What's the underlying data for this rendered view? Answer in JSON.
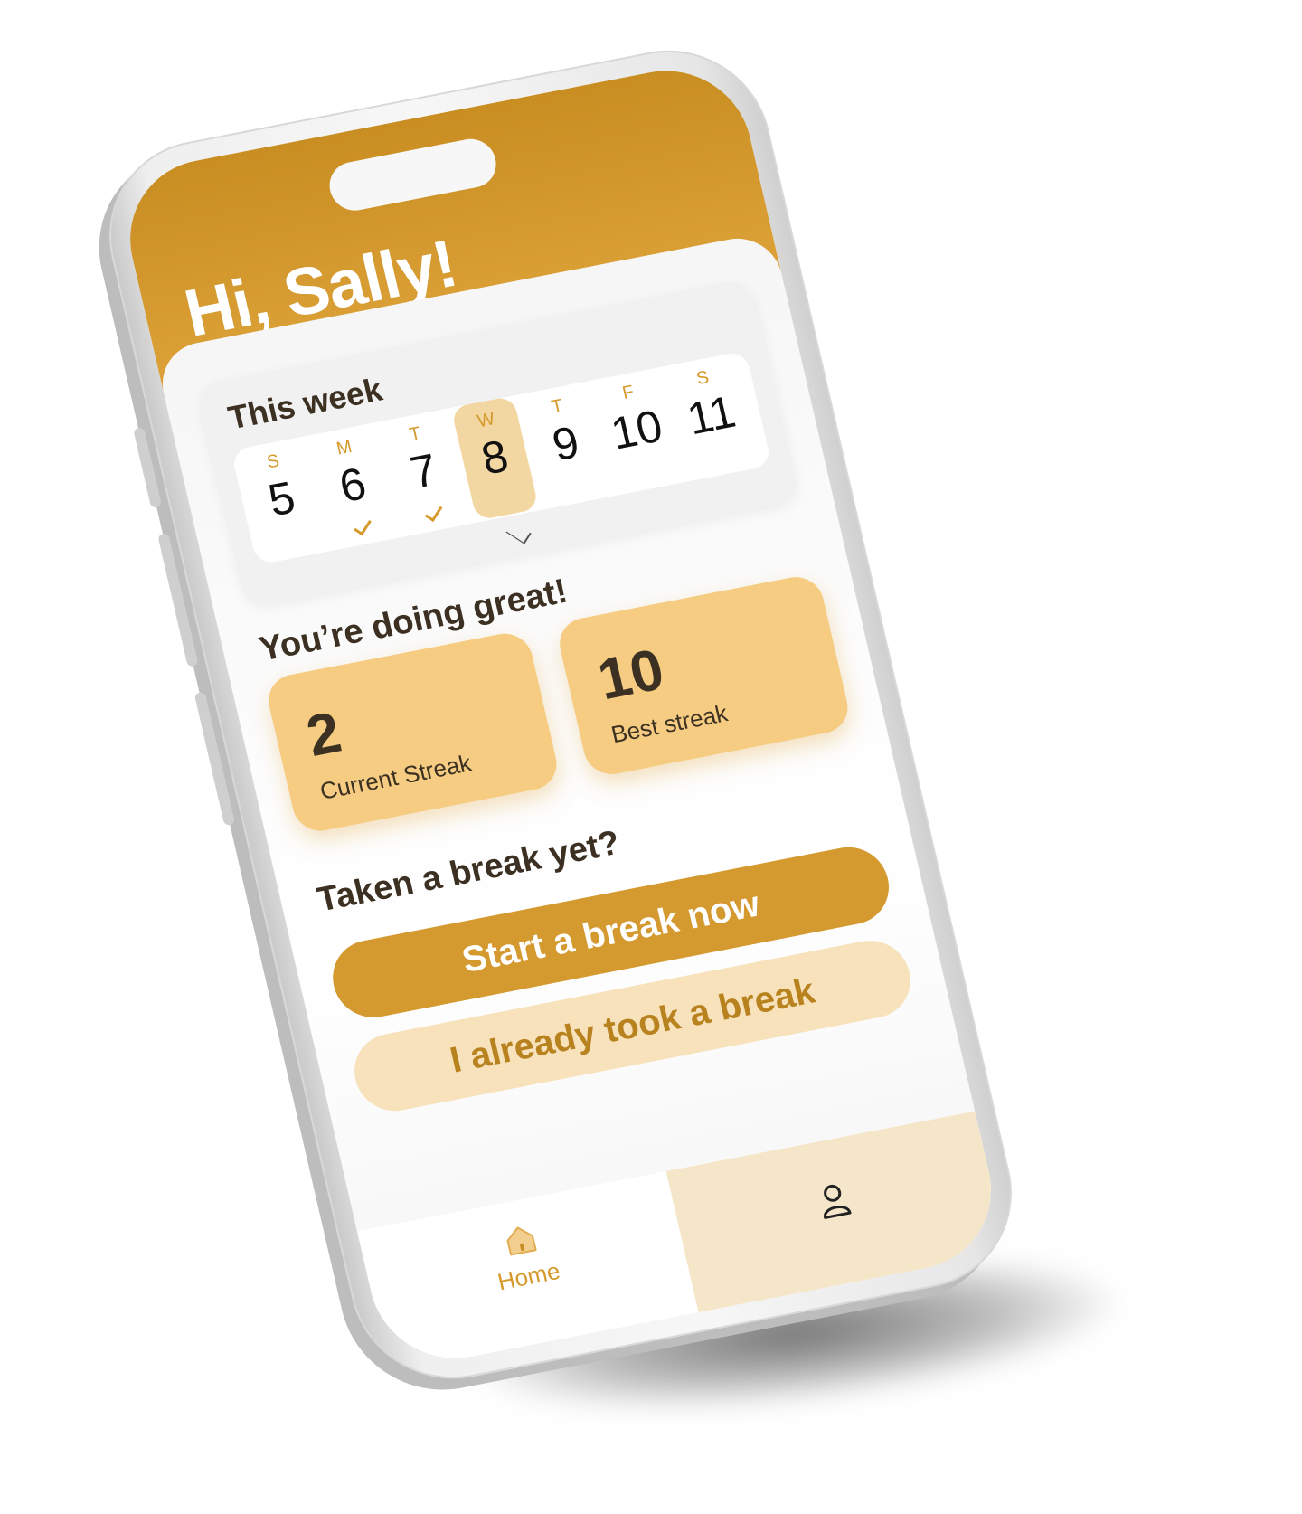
{
  "header": {
    "greeting": "Hi, Sally!"
  },
  "week": {
    "title": "This week",
    "days": [
      {
        "letter": "S",
        "number": "5",
        "completed": false,
        "selected": false
      },
      {
        "letter": "M",
        "number": "6",
        "completed": true,
        "selected": false
      },
      {
        "letter": "T",
        "number": "7",
        "completed": true,
        "selected": false
      },
      {
        "letter": "W",
        "number": "8",
        "completed": false,
        "selected": true
      },
      {
        "letter": "T",
        "number": "9",
        "completed": false,
        "selected": false
      },
      {
        "letter": "F",
        "number": "10",
        "completed": false,
        "selected": false
      },
      {
        "letter": "S",
        "number": "11",
        "completed": false,
        "selected": false
      }
    ]
  },
  "streaks": {
    "title": "You’re doing great!",
    "current": {
      "value": "2",
      "label": "Current Streak"
    },
    "best": {
      "value": "10",
      "label": "Best streak"
    }
  },
  "break": {
    "title": "Taken a break yet?",
    "start_label": "Start a break now",
    "already_label": "I already took a break"
  },
  "tabbar": {
    "home_label": "Home",
    "active_tab": "home"
  },
  "icons": {
    "home": "home-icon",
    "profile": "person-icon",
    "expand": "chevron-down-icon",
    "done": "check-icon"
  },
  "colors": {
    "accent": "#d4992f",
    "accent_light": "#f5cc82",
    "accent_pale": "#f7e2bb",
    "text_dark": "#3b3021"
  }
}
